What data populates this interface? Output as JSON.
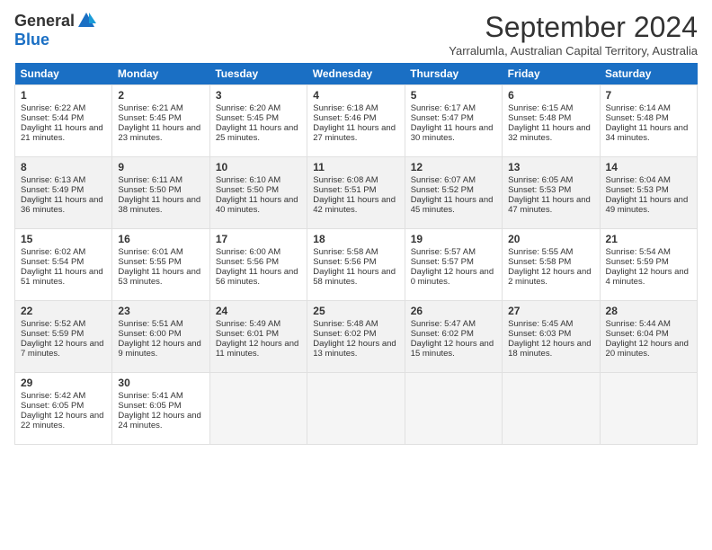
{
  "header": {
    "logo_general": "General",
    "logo_blue": "Blue",
    "title": "September 2024",
    "location": "Yarralumla, Australian Capital Territory, Australia"
  },
  "weekdays": [
    "Sunday",
    "Monday",
    "Tuesday",
    "Wednesday",
    "Thursday",
    "Friday",
    "Saturday"
  ],
  "weeks": [
    [
      {
        "day": 1,
        "sunrise": "6:22 AM",
        "sunset": "5:44 PM",
        "daylight": "11 hours and 21 minutes."
      },
      {
        "day": 2,
        "sunrise": "6:21 AM",
        "sunset": "5:45 PM",
        "daylight": "11 hours and 23 minutes."
      },
      {
        "day": 3,
        "sunrise": "6:20 AM",
        "sunset": "5:45 PM",
        "daylight": "11 hours and 25 minutes."
      },
      {
        "day": 4,
        "sunrise": "6:18 AM",
        "sunset": "5:46 PM",
        "daylight": "11 hours and 27 minutes."
      },
      {
        "day": 5,
        "sunrise": "6:17 AM",
        "sunset": "5:47 PM",
        "daylight": "11 hours and 30 minutes."
      },
      {
        "day": 6,
        "sunrise": "6:15 AM",
        "sunset": "5:48 PM",
        "daylight": "11 hours and 32 minutes."
      },
      {
        "day": 7,
        "sunrise": "6:14 AM",
        "sunset": "5:48 PM",
        "daylight": "11 hours and 34 minutes."
      }
    ],
    [
      {
        "day": 8,
        "sunrise": "6:13 AM",
        "sunset": "5:49 PM",
        "daylight": "11 hours and 36 minutes."
      },
      {
        "day": 9,
        "sunrise": "6:11 AM",
        "sunset": "5:50 PM",
        "daylight": "11 hours and 38 minutes."
      },
      {
        "day": 10,
        "sunrise": "6:10 AM",
        "sunset": "5:50 PM",
        "daylight": "11 hours and 40 minutes."
      },
      {
        "day": 11,
        "sunrise": "6:08 AM",
        "sunset": "5:51 PM",
        "daylight": "11 hours and 42 minutes."
      },
      {
        "day": 12,
        "sunrise": "6:07 AM",
        "sunset": "5:52 PM",
        "daylight": "11 hours and 45 minutes."
      },
      {
        "day": 13,
        "sunrise": "6:05 AM",
        "sunset": "5:53 PM",
        "daylight": "11 hours and 47 minutes."
      },
      {
        "day": 14,
        "sunrise": "6:04 AM",
        "sunset": "5:53 PM",
        "daylight": "11 hours and 49 minutes."
      }
    ],
    [
      {
        "day": 15,
        "sunrise": "6:02 AM",
        "sunset": "5:54 PM",
        "daylight": "11 hours and 51 minutes."
      },
      {
        "day": 16,
        "sunrise": "6:01 AM",
        "sunset": "5:55 PM",
        "daylight": "11 hours and 53 minutes."
      },
      {
        "day": 17,
        "sunrise": "6:00 AM",
        "sunset": "5:56 PM",
        "daylight": "11 hours and 56 minutes."
      },
      {
        "day": 18,
        "sunrise": "5:58 AM",
        "sunset": "5:56 PM",
        "daylight": "11 hours and 58 minutes."
      },
      {
        "day": 19,
        "sunrise": "5:57 AM",
        "sunset": "5:57 PM",
        "daylight": "12 hours and 0 minutes."
      },
      {
        "day": 20,
        "sunrise": "5:55 AM",
        "sunset": "5:58 PM",
        "daylight": "12 hours and 2 minutes."
      },
      {
        "day": 21,
        "sunrise": "5:54 AM",
        "sunset": "5:59 PM",
        "daylight": "12 hours and 4 minutes."
      }
    ],
    [
      {
        "day": 22,
        "sunrise": "5:52 AM",
        "sunset": "5:59 PM",
        "daylight": "12 hours and 7 minutes."
      },
      {
        "day": 23,
        "sunrise": "5:51 AM",
        "sunset": "6:00 PM",
        "daylight": "12 hours and 9 minutes."
      },
      {
        "day": 24,
        "sunrise": "5:49 AM",
        "sunset": "6:01 PM",
        "daylight": "12 hours and 11 minutes."
      },
      {
        "day": 25,
        "sunrise": "5:48 AM",
        "sunset": "6:02 PM",
        "daylight": "12 hours and 13 minutes."
      },
      {
        "day": 26,
        "sunrise": "5:47 AM",
        "sunset": "6:02 PM",
        "daylight": "12 hours and 15 minutes."
      },
      {
        "day": 27,
        "sunrise": "5:45 AM",
        "sunset": "6:03 PM",
        "daylight": "12 hours and 18 minutes."
      },
      {
        "day": 28,
        "sunrise": "5:44 AM",
        "sunset": "6:04 PM",
        "daylight": "12 hours and 20 minutes."
      }
    ],
    [
      {
        "day": 29,
        "sunrise": "5:42 AM",
        "sunset": "6:05 PM",
        "daylight": "12 hours and 22 minutes."
      },
      {
        "day": 30,
        "sunrise": "5:41 AM",
        "sunset": "6:05 PM",
        "daylight": "12 hours and 24 minutes."
      },
      null,
      null,
      null,
      null,
      null
    ]
  ],
  "labels": {
    "sunrise": "Sunrise: ",
    "sunset": "Sunset: ",
    "daylight": "Daylight hours"
  }
}
